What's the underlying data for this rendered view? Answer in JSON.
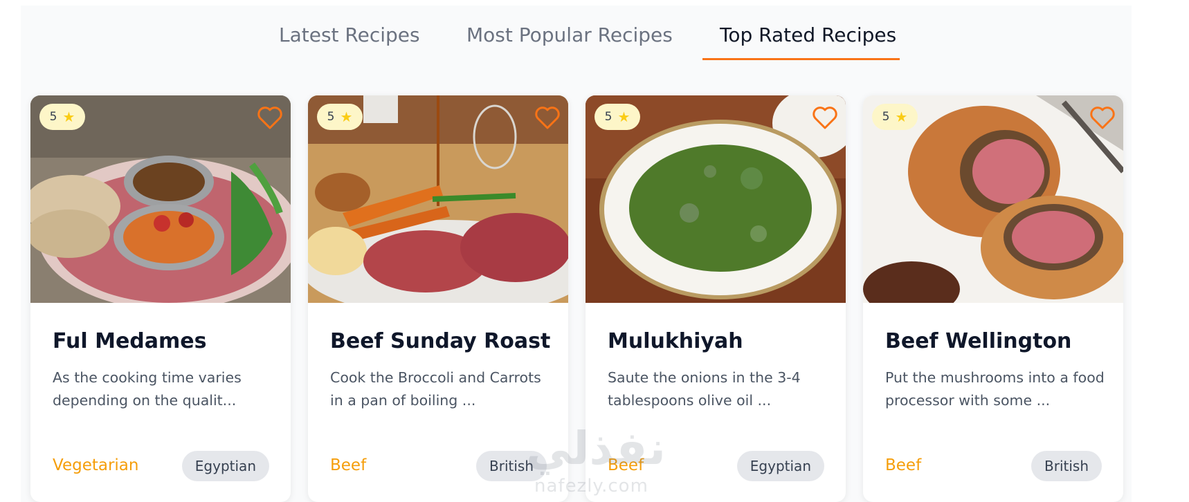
{
  "tabs": [
    {
      "label": "Latest Recipes",
      "active": false
    },
    {
      "label": "Most Popular Recipes",
      "active": false
    },
    {
      "label": "Top Rated Recipes",
      "active": true
    }
  ],
  "accent_color": "#f97316",
  "cards": [
    {
      "rating": "5",
      "title": "Ful Medames",
      "description": "As the cooking time varies depending on the qualit...",
      "category": "Vegetarian",
      "area": "Egyptian"
    },
    {
      "rating": "5",
      "title": "Beef Sunday Roast",
      "description": "Cook the Broccoli and Carrots in a pan of boiling ...",
      "category": "Beef",
      "area": "British"
    },
    {
      "rating": "5",
      "title": "Mulukhiyah",
      "description": "Saute the onions in the 3-4 tablespoons olive oil ...",
      "category": "Beef",
      "area": "Egyptian"
    },
    {
      "rating": "5",
      "title": "Beef Wellington",
      "description": "Put the mushrooms into a food processor with some ...",
      "category": "Beef",
      "area": "British"
    }
  ],
  "icons": {
    "rating": "star-icon",
    "favorite": "heart-icon"
  },
  "watermark": {
    "arabic": "نفذلي",
    "latin": "nafezly.com"
  }
}
